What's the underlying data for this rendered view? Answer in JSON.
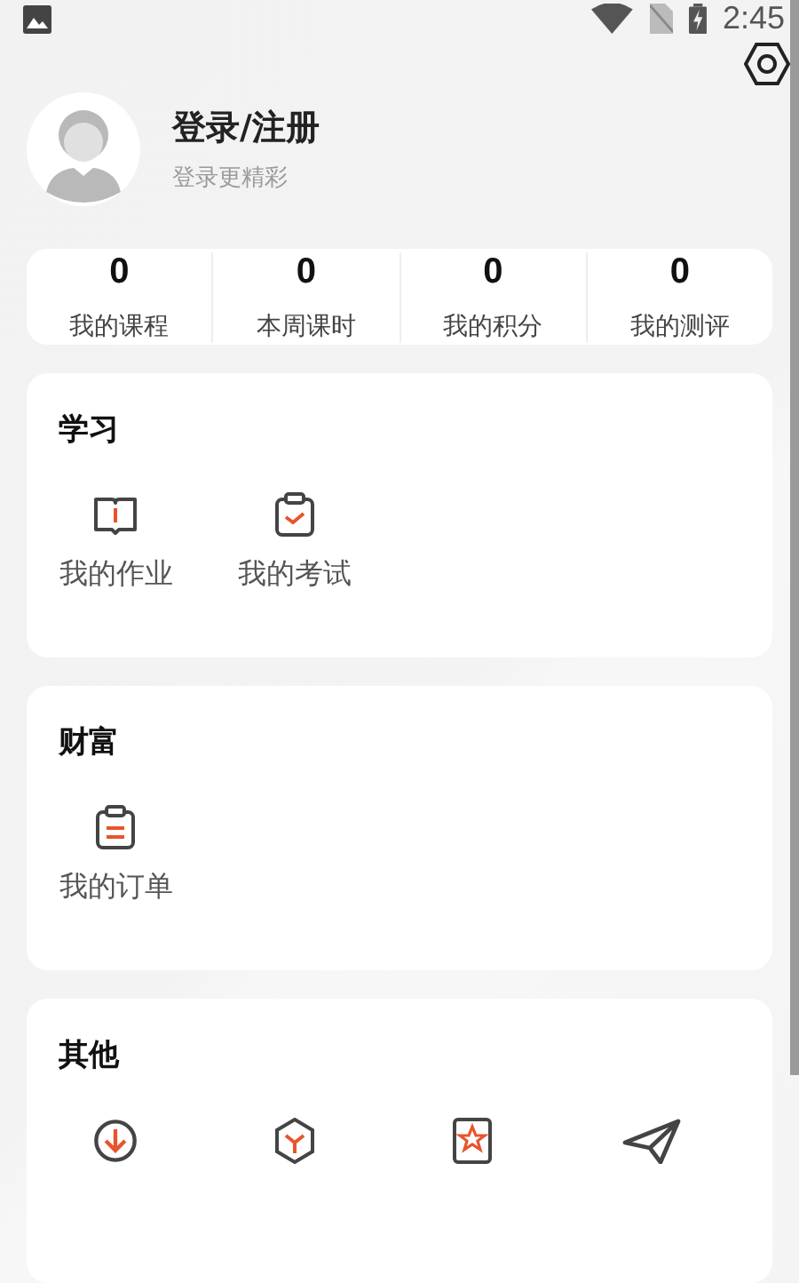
{
  "status_bar": {
    "time": "2:45"
  },
  "profile": {
    "name": "登录/注册",
    "subtitle": "登录更精彩"
  },
  "stats": [
    {
      "value": "0",
      "label": "我的课程"
    },
    {
      "value": "0",
      "label": "本周课时"
    },
    {
      "value": "0",
      "label": "我的积分"
    },
    {
      "value": "0",
      "label": "我的测评"
    }
  ],
  "sections": [
    {
      "title": "学习",
      "items": [
        {
          "kind": "tile",
          "label": "我的作业"
        },
        {
          "kind": "tile",
          "label": "我的考试"
        }
      ]
    },
    {
      "title": "财富",
      "items": [
        {
          "kind": "tile",
          "label": "我的订单"
        }
      ]
    },
    {
      "title": "其他",
      "items": [
        {
          "kind": "tile"
        },
        {
          "kind": "tile"
        },
        {
          "kind": "tile"
        },
        {
          "kind": "tile"
        }
      ]
    }
  ]
}
